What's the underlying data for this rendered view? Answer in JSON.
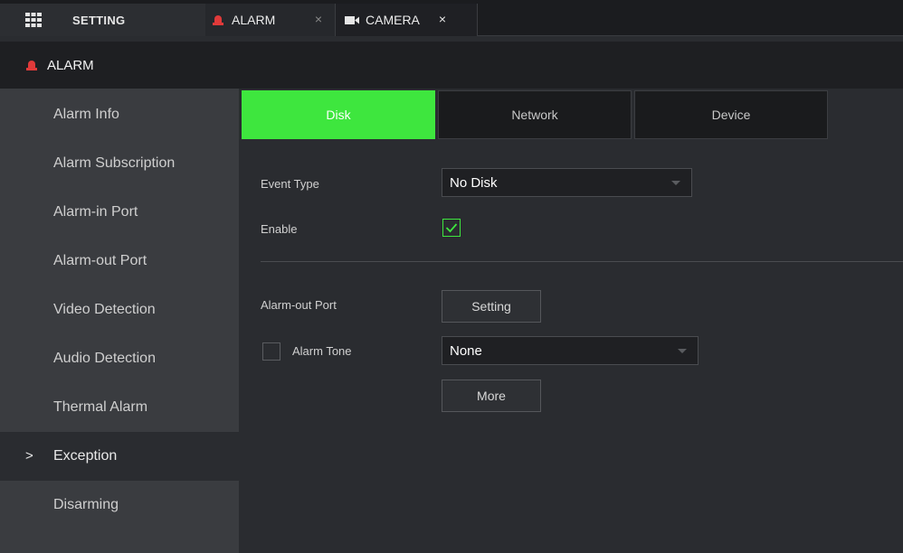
{
  "tabs": {
    "setting": {
      "label": "SETTING",
      "icon": "grid-menu-icon"
    },
    "alarm": {
      "label": "ALARM",
      "icon": "alarm-siren-icon",
      "close": "×"
    },
    "camera": {
      "label": "CAMERA",
      "icon": "camera-icon",
      "close": "×"
    }
  },
  "title": {
    "label": "ALARM",
    "icon": "alarm-siren-icon"
  },
  "sidebar": {
    "items": [
      {
        "label": "Alarm Info"
      },
      {
        "label": "Alarm Subscription"
      },
      {
        "label": "Alarm-in Port"
      },
      {
        "label": "Alarm-out Port"
      },
      {
        "label": "Video Detection"
      },
      {
        "label": "Audio Detection"
      },
      {
        "label": "Thermal Alarm"
      },
      {
        "label": "Exception",
        "active": true
      },
      {
        "label": "Disarming"
      }
    ],
    "active_marker": ">"
  },
  "subtabs": [
    {
      "label": "Disk",
      "active": true
    },
    {
      "label": "Network"
    },
    {
      "label": "Device"
    }
  ],
  "form": {
    "event_type": {
      "label": "Event Type",
      "value": "No Disk"
    },
    "enable": {
      "label": "Enable",
      "checked": true
    },
    "alarm_out_port": {
      "label": "Alarm-out Port",
      "button": "Setting"
    },
    "alarm_tone": {
      "label": "Alarm Tone",
      "checked": false,
      "value": "None"
    },
    "more_button": "More"
  },
  "colors": {
    "accent": "#3ee63e",
    "alarm_red": "#e03a3a",
    "background": "#2a2c30",
    "sidebar": "#3a3c40"
  }
}
